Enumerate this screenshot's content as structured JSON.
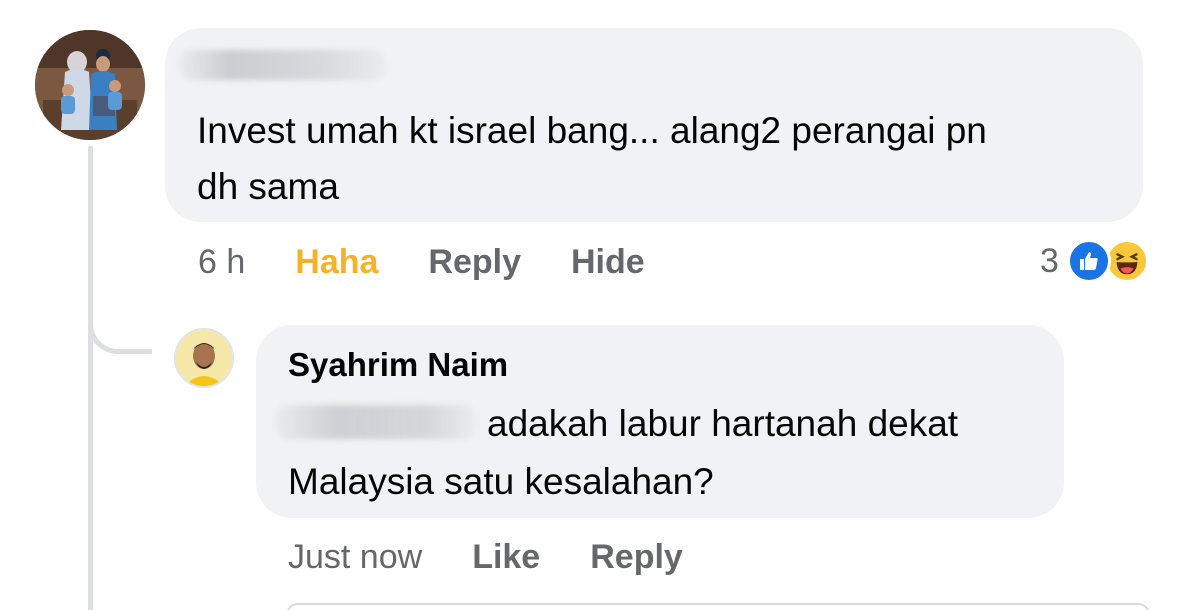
{
  "thread": {
    "comment": {
      "author_name_redacted": true,
      "text": "Invest umah kt israel bang... alang2 perangai pn\ndh sama",
      "time": "6 h",
      "actions": {
        "reaction_label": "Haha",
        "reply_label": "Reply",
        "hide_label": "Hide"
      },
      "reactions": {
        "count": "3",
        "types": [
          "like-icon",
          "haha-icon"
        ]
      }
    },
    "reply": {
      "author": "Syahrim Naim",
      "mention_redacted": true,
      "text_line1": "adakah labur hartanah dekat",
      "text_line2": "Malaysia satu kesalahan?",
      "time": "Just now",
      "actions": {
        "like_label": "Like",
        "reply_label": "Reply"
      }
    }
  },
  "colors": {
    "bubble": "#f0f2f5",
    "meta_text": "#65676b",
    "haha_reaction": "#f7b125",
    "like_blue": "#1b74e4",
    "haha_yellow": "#f8c83a"
  }
}
